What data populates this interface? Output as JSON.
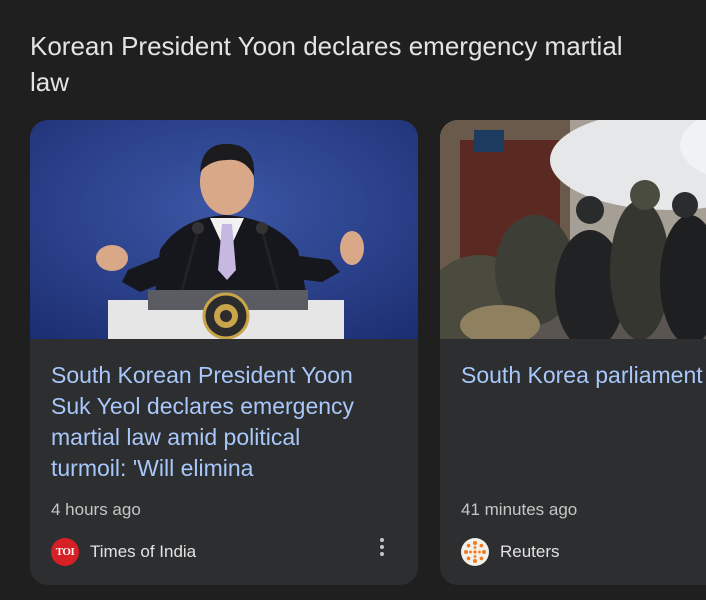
{
  "section": {
    "title": "Korean President Yoon declares emergency martial law"
  },
  "cards": [
    {
      "headline": "South Korean President Yoon\nSuk Yeol declares emergency\nmartial law amid political\nturmoil: 'Will elimina",
      "time": "4 hours ago",
      "source": "Times of India",
      "source_logo_text": "TOI",
      "image_icon": "photo-president-at-podium",
      "more_icon": "more-vertical-icon"
    },
    {
      "headline": "South Korea parliament\nrejects president's martial law\ndeclaration",
      "time": "41 minutes ago",
      "source": "Reuters",
      "image_icon": "photo-soldiers-in-hallway"
    }
  ],
  "colors": {
    "background": "#1f1f1f",
    "card": "#2d2e30",
    "headline": "#a8c7fa",
    "title": "#e3e3e3",
    "meta": "#c4c7c5",
    "toi_red": "#d71f26"
  }
}
